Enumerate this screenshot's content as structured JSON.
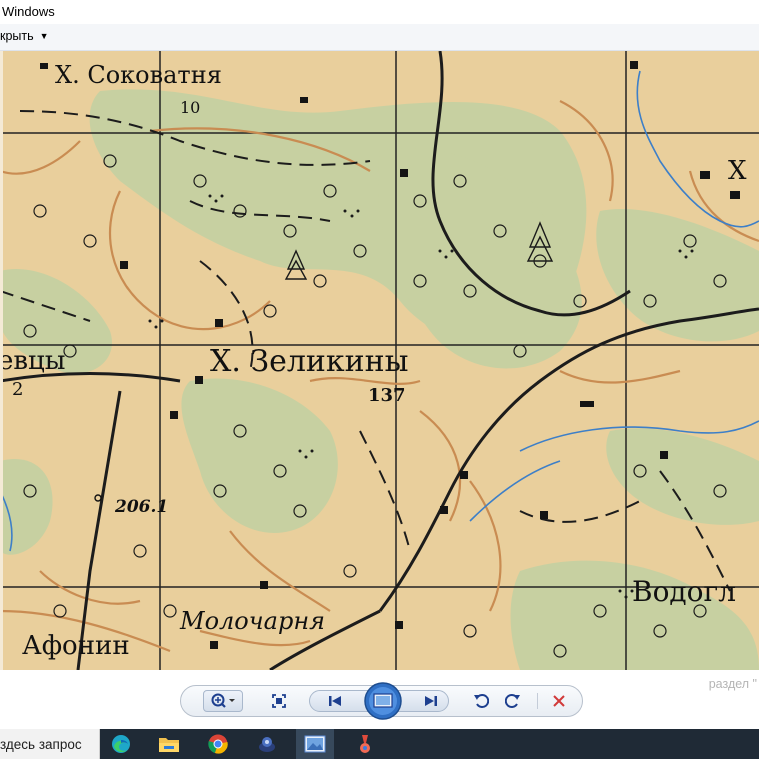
{
  "window": {
    "title": "Windows"
  },
  "menu": {
    "open_label": "крыть"
  },
  "map": {
    "labels": {
      "sokovatnya": "Х. Соковатня",
      "num10": "10",
      "zelikiny": "Х. Зеликины",
      "evtsy": "евцы",
      "num2": "2",
      "elev137": "137",
      "elev206": "206.1",
      "molochar": "Молочарня",
      "afonin": "Афонин",
      "vodogl": "Водогл",
      "khutor_right": "Х"
    }
  },
  "viewer": {
    "hint": "раздел \""
  },
  "controls": {
    "icons": [
      "zoom-icon",
      "fit-window-icon",
      "previous-icon",
      "slideshow-icon",
      "next-icon",
      "rotate-left-icon",
      "rotate-right-icon",
      "delete-icon"
    ]
  },
  "taskbar": {
    "search_text": "здесь запрос",
    "apps": [
      "edge-icon",
      "file-explorer-icon",
      "chrome-icon",
      "security-app-icon",
      "photo-viewer-icon",
      "paint-app-icon"
    ]
  },
  "colors": {
    "map_paper": "#ecd3a4",
    "forest": "#c7d0a1",
    "contour": "#c98c52",
    "river": "#3d7fc8",
    "delete_red": "#d13a3a",
    "taskbar": "#1f2a36"
  }
}
